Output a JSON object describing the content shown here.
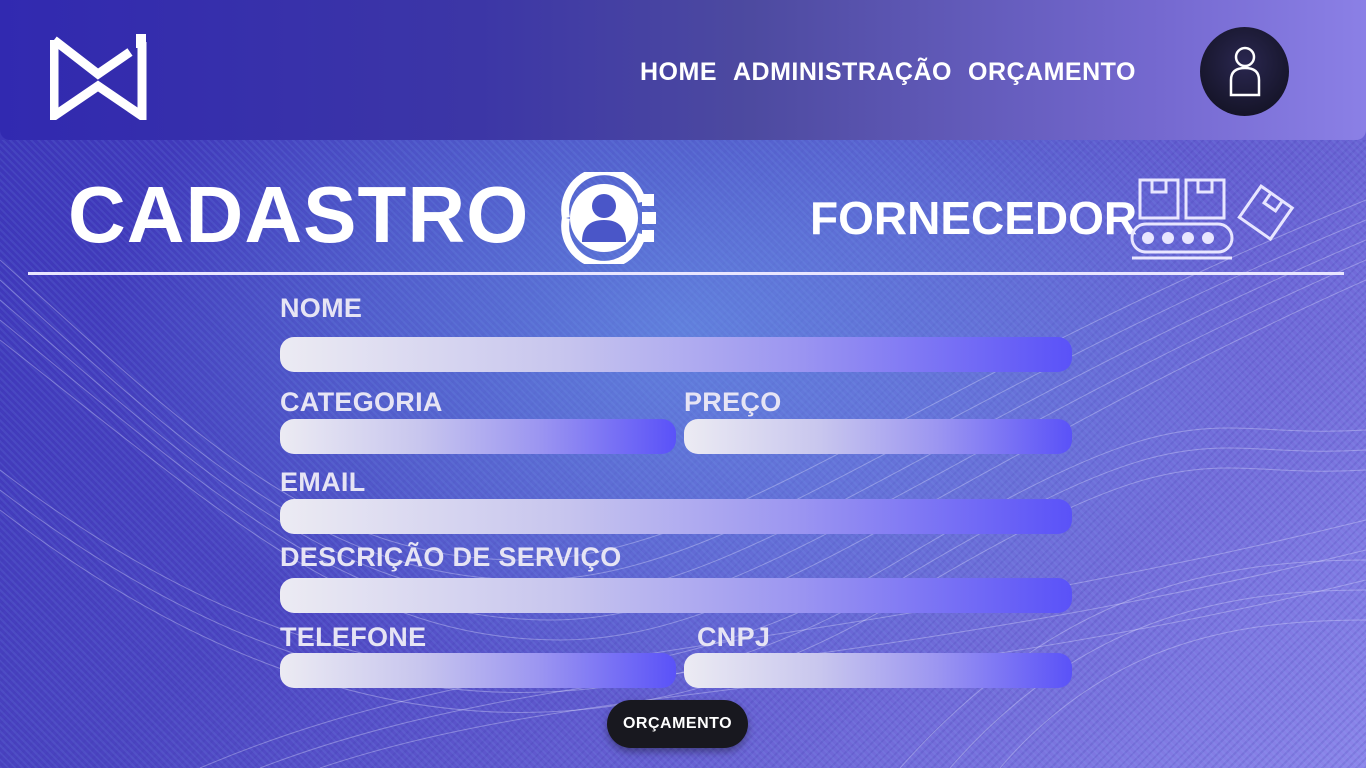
{
  "nav": {
    "items": [
      {
        "label": "HOME"
      },
      {
        "label": "ADMINISTRAÇÃO"
      },
      {
        "label": "ORÇAMENTO"
      }
    ]
  },
  "page": {
    "title": "CADASTRO",
    "subtitle": "FORNECEDOR"
  },
  "form": {
    "fields": {
      "nome": {
        "label": "NOME",
        "value": ""
      },
      "categoria": {
        "label": "CATEGORIA",
        "value": ""
      },
      "preco": {
        "label": "PREÇO",
        "value": ""
      },
      "email": {
        "label": "EMAIL",
        "value": ""
      },
      "descricao": {
        "label": "DESCRIÇÃO DE SERVIÇO",
        "value": ""
      },
      "telefone": {
        "label": "TELEFONE",
        "value": ""
      },
      "cnpj": {
        "label": "CNPJ",
        "value": ""
      }
    },
    "submit_label": "ORÇAMENTO"
  },
  "icons": {
    "logo": "brand-logo-icon",
    "avatar": "user-icon",
    "title": "user-gear-icon",
    "supplier": "conveyor-boxes-icon"
  },
  "colors": {
    "background_start": "#3a33b8",
    "background_end": "#8d86ea",
    "input_gradient_start": "#ecebf3",
    "input_gradient_end": "#5a52f8",
    "button": "#18181f"
  }
}
